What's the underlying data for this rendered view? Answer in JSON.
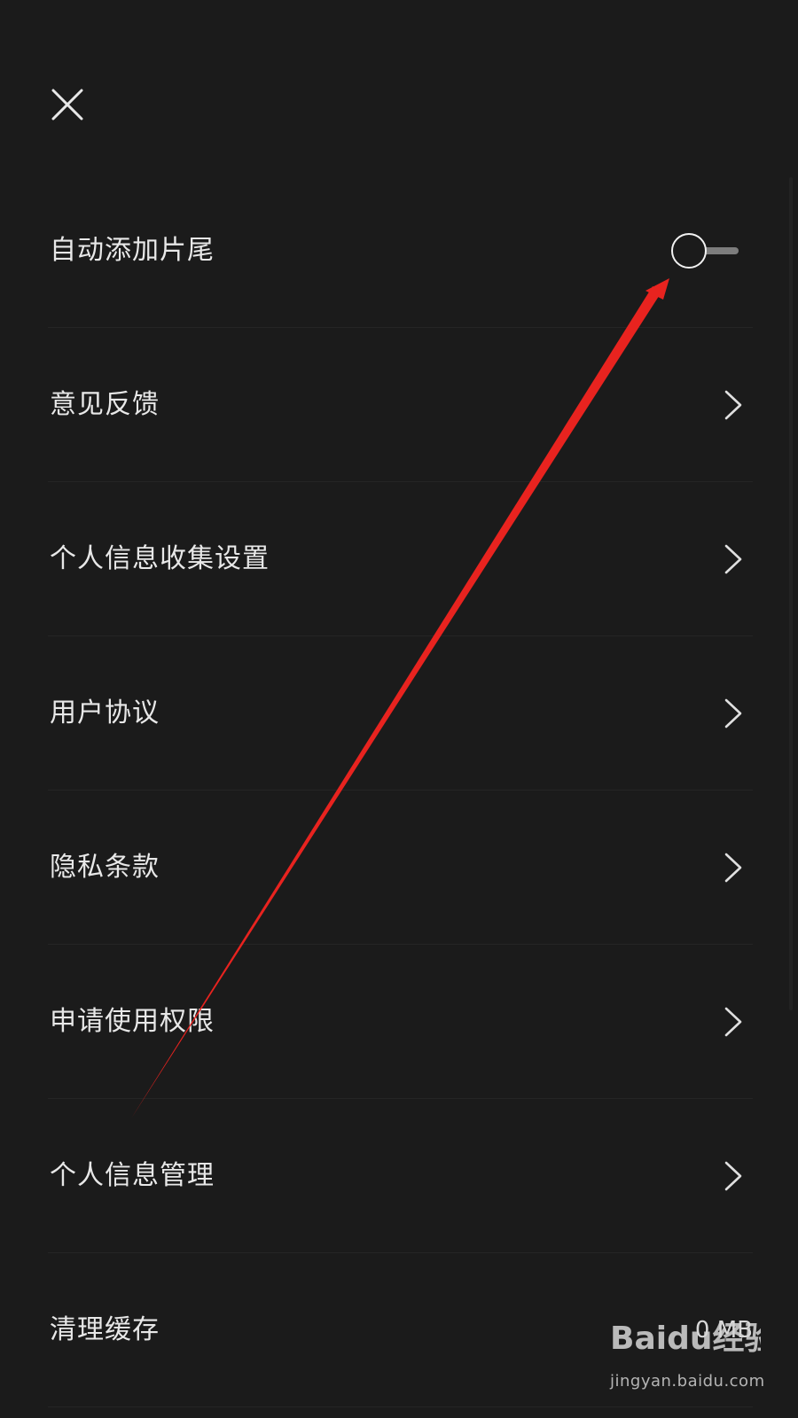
{
  "header": {
    "close_icon": "close-icon"
  },
  "settings": {
    "items": [
      {
        "label": "自动添加片尾",
        "control": "toggle",
        "toggle_on": false
      },
      {
        "label": "意见反馈",
        "control": "chevron"
      },
      {
        "label": "个人信息收集设置",
        "control": "chevron"
      },
      {
        "label": "用户协议",
        "control": "chevron"
      },
      {
        "label": "隐私条款",
        "control": "chevron"
      },
      {
        "label": "申请使用权限",
        "control": "chevron"
      },
      {
        "label": "个人信息管理",
        "control": "chevron"
      },
      {
        "label": "清理缓存",
        "control": "value",
        "value": "0 MB"
      }
    ]
  },
  "annotation": {
    "color": "#e8231f"
  },
  "watermark": {
    "logo_text": "Baidu经验",
    "url": "jingyan.baidu.com"
  },
  "colors": {
    "background": "#1b1b1b",
    "text": "#e8e8e8",
    "divider": "#252525"
  }
}
